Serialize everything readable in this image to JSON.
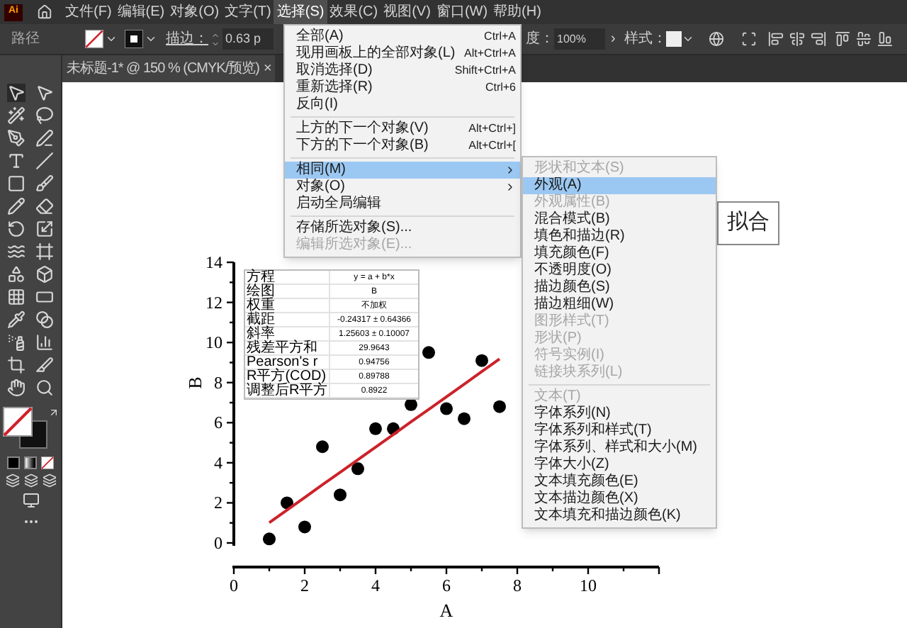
{
  "app": {
    "logo": "Ai"
  },
  "menu_bar": [
    {
      "label": "文件(F)",
      "selected": false
    },
    {
      "label": "编辑(E)",
      "selected": false
    },
    {
      "label": "对象(O)",
      "selected": false
    },
    {
      "label": "文字(T)",
      "selected": false
    },
    {
      "label": "选择(S)",
      "selected": true
    },
    {
      "label": "效果(C)",
      "selected": false
    },
    {
      "label": "视图(V)",
      "selected": false
    },
    {
      "label": "窗口(W)",
      "selected": false
    },
    {
      "label": "帮助(H)",
      "selected": false
    }
  ],
  "control_bar": {
    "object_type": "路径",
    "stroke_label": "描边：",
    "stroke_value": "0.63 p",
    "opacity_label": "度：",
    "opacity_value": "100%",
    "opacity_arrow": "›",
    "style_label": "样式："
  },
  "document_tab": {
    "title": "未标题-1* @ 150 % (CMYK/预览)",
    "close": "×"
  },
  "select_menu": {
    "items": [
      {
        "kind": "item",
        "label": "全部(A)",
        "shortcut": "Ctrl+A",
        "selected": false,
        "disabled": false,
        "submenu": false
      },
      {
        "kind": "item",
        "label": "现用画板上的全部对象(L)",
        "shortcut": "Alt+Ctrl+A",
        "selected": false,
        "disabled": false,
        "submenu": false
      },
      {
        "kind": "item",
        "label": "取消选择(D)",
        "shortcut": "Shift+Ctrl+A",
        "selected": false,
        "disabled": false,
        "submenu": false
      },
      {
        "kind": "item",
        "label": "重新选择(R)",
        "shortcut": "Ctrl+6",
        "selected": false,
        "disabled": false,
        "submenu": false
      },
      {
        "kind": "item",
        "label": "反向(I)",
        "selected": false,
        "disabled": false,
        "submenu": false
      },
      {
        "kind": "separator"
      },
      {
        "kind": "item",
        "label": "上方的下一个对象(V)",
        "shortcut": "Alt+Ctrl+]",
        "selected": false,
        "disabled": false,
        "submenu": false
      },
      {
        "kind": "item",
        "label": "下方的下一个对象(B)",
        "shortcut": "Alt+Ctrl+[",
        "selected": false,
        "disabled": false,
        "submenu": false
      },
      {
        "kind": "separator"
      },
      {
        "kind": "item",
        "label": "相同(M)",
        "selected": true,
        "disabled": false,
        "submenu": true
      },
      {
        "kind": "item",
        "label": "对象(O)",
        "selected": false,
        "disabled": false,
        "submenu": true
      },
      {
        "kind": "item",
        "label": "启动全局编辑",
        "selected": false,
        "disabled": false,
        "submenu": false
      },
      {
        "kind": "separator"
      },
      {
        "kind": "item",
        "label": "存储所选对象(S)...",
        "selected": false,
        "disabled": false,
        "submenu": false
      },
      {
        "kind": "item",
        "label": "编辑所选对象(E)...",
        "selected": false,
        "disabled": true,
        "submenu": false
      }
    ]
  },
  "same_submenu": {
    "items": [
      {
        "kind": "item",
        "label": "形状和文本(S)",
        "selected": false,
        "disabled": true
      },
      {
        "kind": "item",
        "label": "外观(A)",
        "selected": true,
        "disabled": false
      },
      {
        "kind": "item",
        "label": "外观属性(B)",
        "selected": false,
        "disabled": true
      },
      {
        "kind": "item",
        "label": "混合模式(B)",
        "selected": false,
        "disabled": false
      },
      {
        "kind": "item",
        "label": "填色和描边(R)",
        "selected": false,
        "disabled": false
      },
      {
        "kind": "item",
        "label": "填充颜色(F)",
        "selected": false,
        "disabled": false
      },
      {
        "kind": "item",
        "label": "不透明度(O)",
        "selected": false,
        "disabled": false
      },
      {
        "kind": "item",
        "label": "描边颜色(S)",
        "selected": false,
        "disabled": false
      },
      {
        "kind": "item",
        "label": "描边粗细(W)",
        "selected": false,
        "disabled": false
      },
      {
        "kind": "item",
        "label": "图形样式(T)",
        "selected": false,
        "disabled": true
      },
      {
        "kind": "item",
        "label": "形状(P)",
        "selected": false,
        "disabled": true
      },
      {
        "kind": "item",
        "label": "符号实例(I)",
        "selected": false,
        "disabled": true
      },
      {
        "kind": "item",
        "label": "链接块系列(L)",
        "selected": false,
        "disabled": true
      },
      {
        "kind": "separator"
      },
      {
        "kind": "item",
        "label": "文本(T)",
        "selected": false,
        "disabled": true
      },
      {
        "kind": "item",
        "label": "字体系列(N)",
        "selected": false,
        "disabled": false
      },
      {
        "kind": "item",
        "label": "字体系列和样式(T)",
        "selected": false,
        "disabled": false
      },
      {
        "kind": "item",
        "label": "字体系列、样式和大小(M)",
        "selected": false,
        "disabled": false
      },
      {
        "kind": "item",
        "label": "字体大小(Z)",
        "selected": false,
        "disabled": false
      },
      {
        "kind": "item",
        "label": "文本填充颜色(E)",
        "selected": false,
        "disabled": false
      },
      {
        "kind": "item",
        "label": "文本描边颜色(X)",
        "selected": false,
        "disabled": false
      },
      {
        "kind": "item",
        "label": "文本填充和描边颜色(K)",
        "selected": false,
        "disabled": false
      }
    ]
  },
  "canvas": {
    "title_fragment": "拟合",
    "stats_table": {
      "rows": [
        {
          "label": "方程",
          "value": "y = a + b*x"
        },
        {
          "label": "绘图",
          "value": "B"
        },
        {
          "label": "权重",
          "value": "不加权"
        },
        {
          "label": "截距",
          "value": "-0.24317 ± 0.64366"
        },
        {
          "label": "斜率",
          "value": "1.25603 ± 0.10007"
        },
        {
          "label": "残差平方和",
          "value": "29.9643"
        },
        {
          "label": "Pearson's r",
          "value": "0.94756"
        },
        {
          "label": "R平方(COD)",
          "value": "0.89788"
        },
        {
          "label": "调整后R平方",
          "value": "0.8922"
        }
      ]
    },
    "chart_data": {
      "type": "scatter",
      "xlabel": "A",
      "ylabel": "B",
      "x": [
        1,
        1.5,
        2,
        2.5,
        3,
        3.5,
        4,
        4.5,
        5,
        5.5,
        6,
        6.5,
        7,
        7.5
      ],
      "series": [
        {
          "color": "#000000",
          "values": [
            0.2,
            2,
            0.8,
            4.8,
            2.4,
            3.7,
            5.7,
            5.7,
            6.9,
            9.5,
            6.7,
            6.2,
            9.1,
            6.8
          ]
        },
        {
          "type": "line",
          "color": "#cc2229",
          "values": [
            1.01,
            1.64,
            2.27,
            2.9,
            3.52,
            4.15,
            4.78,
            5.41,
            6.04,
            6.66,
            7.29,
            7.92,
            8.55,
            9.18
          ]
        }
      ],
      "xlim": [
        0,
        12
      ],
      "ylim": [
        0,
        14
      ],
      "xticks": [
        0,
        2,
        4,
        6,
        8,
        10
      ],
      "yticks": [
        0,
        2,
        4,
        6,
        8,
        10,
        12,
        14
      ]
    }
  }
}
